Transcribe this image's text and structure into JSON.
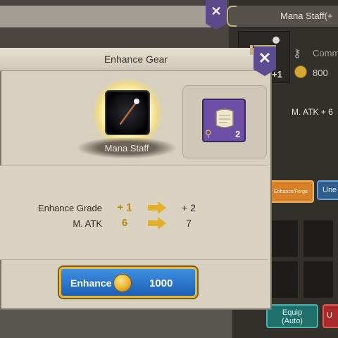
{
  "background": {
    "right_title": "Mana Staff(+",
    "item_plus": "+1",
    "comm_text": "Comm",
    "price_text": "800",
    "stat_text": "M. ATK + 6",
    "forge_button": "Enhance/Forge",
    "une_button": "Une",
    "equip_button_line1": "Equip",
    "equip_button_line2": "(Auto)",
    "red_button": "U"
  },
  "modal": {
    "title": "Enhance Gear",
    "close_icon": "close-x-icon",
    "gear_name": "Mana Staff",
    "scroll_count": "2",
    "stats": [
      {
        "label": "Enhance Grade",
        "from": "+ 1",
        "to": "+ 2"
      },
      {
        "label": "M. ATK",
        "from": "6",
        "to": "7"
      }
    ],
    "enhance_button": {
      "label": "Enhance",
      "cost": "1000"
    }
  },
  "colors": {
    "accent_gold": "#e0b743",
    "button_blue": "#1c5fb4",
    "flag_purple": "#5b4c91"
  }
}
